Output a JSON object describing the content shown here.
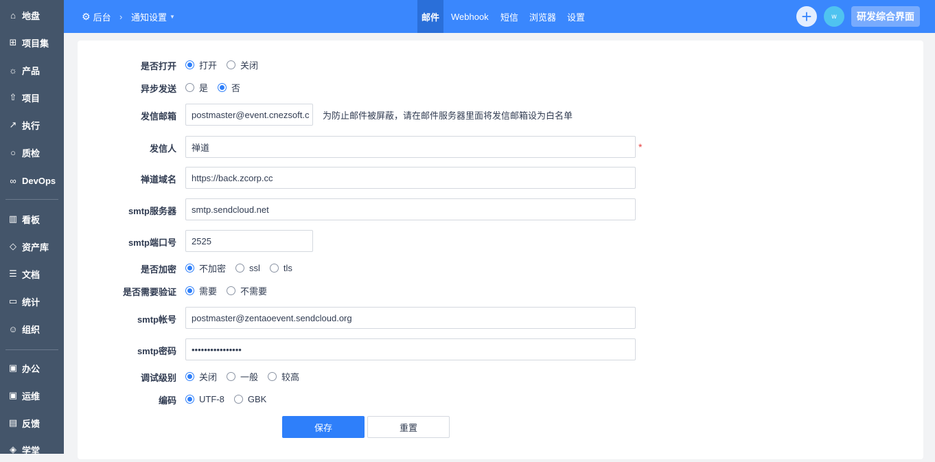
{
  "sidebar": {
    "items": [
      {
        "label": "地盘",
        "icon": "home-icon"
      },
      {
        "label": "项目集",
        "icon": "grid-icon"
      },
      {
        "label": "产品",
        "icon": "bulb-icon"
      },
      {
        "label": "项目",
        "icon": "rocket-icon"
      },
      {
        "label": "执行",
        "icon": "run-icon"
      },
      {
        "label": "质检",
        "icon": "search-icon"
      },
      {
        "label": "DevOps",
        "icon": "infinity-icon"
      },
      {
        "label": "看板",
        "icon": "kanban-icon"
      },
      {
        "label": "资产库",
        "icon": "diamond-icon"
      },
      {
        "label": "文档",
        "icon": "doc-icon"
      },
      {
        "label": "统计",
        "icon": "chart-icon"
      },
      {
        "label": "组织",
        "icon": "people-icon"
      },
      {
        "label": "办公",
        "icon": "oa-icon"
      },
      {
        "label": "运维",
        "icon": "ops-icon"
      },
      {
        "label": "反馈",
        "icon": "feedback-icon"
      },
      {
        "label": "学堂",
        "icon": "school-icon"
      }
    ]
  },
  "header": {
    "breadcrumb": [
      "后台",
      "通知设置"
    ],
    "tabs": [
      "邮件",
      "Webhook",
      "短信",
      "浏览器",
      "设置"
    ],
    "active_tab": "邮件",
    "avatar": "w",
    "app_switch": "研发综合界面"
  },
  "form": {
    "enable": {
      "label": "是否打开",
      "options": [
        "打开",
        "关闭"
      ],
      "selected": "打开"
    },
    "async": {
      "label": "异步发送",
      "options": [
        "是",
        "否"
      ],
      "selected": "否"
    },
    "from_addr": {
      "label": "发信邮箱",
      "value": "postmaster@event.cnezsoft.c",
      "hint": "为防止邮件被屏蔽，请在邮件服务器里面将发信邮箱设为白名单"
    },
    "from_name": {
      "label": "发信人",
      "value": "禅道",
      "required": "*"
    },
    "domain": {
      "label": "禅道域名",
      "value": "https://back.zcorp.cc"
    },
    "smtp_host": {
      "label": "smtp服务器",
      "value": "smtp.sendcloud.net"
    },
    "smtp_port": {
      "label": "smtp端口号",
      "value": "2525"
    },
    "secure": {
      "label": "是否加密",
      "options": [
        "不加密",
        "ssl",
        "tls"
      ],
      "selected": "不加密"
    },
    "auth": {
      "label": "是否需要验证",
      "options": [
        "需要",
        "不需要"
      ],
      "selected": "需要"
    },
    "username": {
      "label": "smtp帐号",
      "value": "postmaster@zentaoevent.sendcloud.org"
    },
    "password": {
      "label": "smtp密码",
      "value": "••••••••••••••••"
    },
    "debug": {
      "label": "调试级别",
      "options": [
        "关闭",
        "一般",
        "较高"
      ],
      "selected": "关闭"
    },
    "charset": {
      "label": "编码",
      "options": [
        "UTF-8",
        "GBK"
      ],
      "selected": "UTF-8"
    },
    "save": "保存",
    "reset": "重置"
  }
}
